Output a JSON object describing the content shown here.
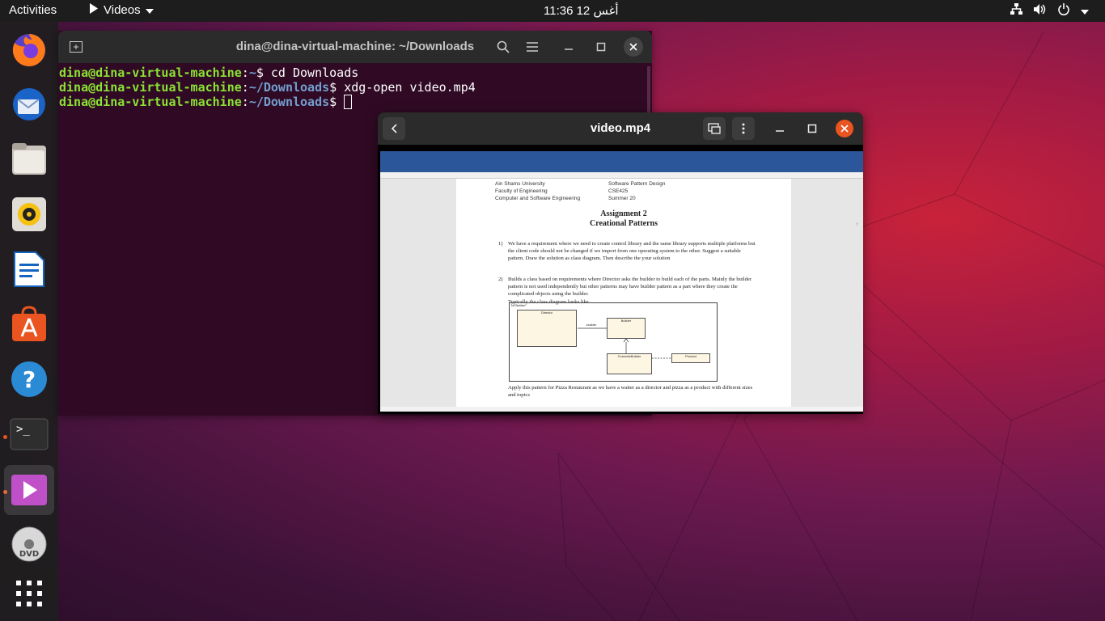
{
  "topbar": {
    "activities": "Activities",
    "app_name": "Videos",
    "clock": "11:36  أغس 12"
  },
  "dock": {
    "items": [
      "firefox-icon",
      "thunderbird-icon",
      "files-icon",
      "rhythmbox-icon",
      "writer-icon",
      "software-icon",
      "help-icon",
      "terminal-icon",
      "videos-icon",
      "dvd-icon",
      "show-apps-icon"
    ]
  },
  "terminal": {
    "title": "dina@dina-virtual-machine: ~/Downloads",
    "lines": [
      {
        "user": "dina@dina-virtual-machine",
        "path": "~",
        "cmd": "cd Downloads"
      },
      {
        "user": "dina@dina-virtual-machine",
        "path": "~/Downloads",
        "cmd": "xdg-open video.mp4"
      },
      {
        "user": "dina@dina-virtual-machine",
        "path": "~/Downloads",
        "cmd": ""
      }
    ]
  },
  "video": {
    "title": "video.mp4",
    "doc": {
      "header_left": [
        "Ain Shams University",
        "Faculty of Engineering",
        "Computer and Software Engineering"
      ],
      "header_right": [
        "Software Pattern Design",
        "CSE425",
        "Summer 20"
      ],
      "title1": "Assignment 2",
      "title2": "Creational Patterns",
      "q1_num": "1)",
      "q1": "We have a requirement where we need to create control library and the same library supports multiple platforms but the client code should not be changed if we import from one operating system to the other. Suggest a suitable pattern. Draw the solution as class diagram. Then describe the your solution",
      "q2_num": "2)",
      "q2": "Builds a class based on requirements where Director asks the builder to build each of the parts. Mainly the builder pattern is not used independently but other patterns may have builder pattern as a part where they create the complicated objects using the builder.",
      "q2b": "Typically the class diagram looks like",
      "q2c": "Apply this pattern for Pizza Restaurant as we have a waiter as a director and pizza as a product with different sizes and topics",
      "diagram_label": "cd Builder",
      "box_director": "Director",
      "box_builder": "Builder",
      "box_concrete": "ConcreteBuilder",
      "box_product": "Product",
      "builder_label": "-builder"
    }
  }
}
